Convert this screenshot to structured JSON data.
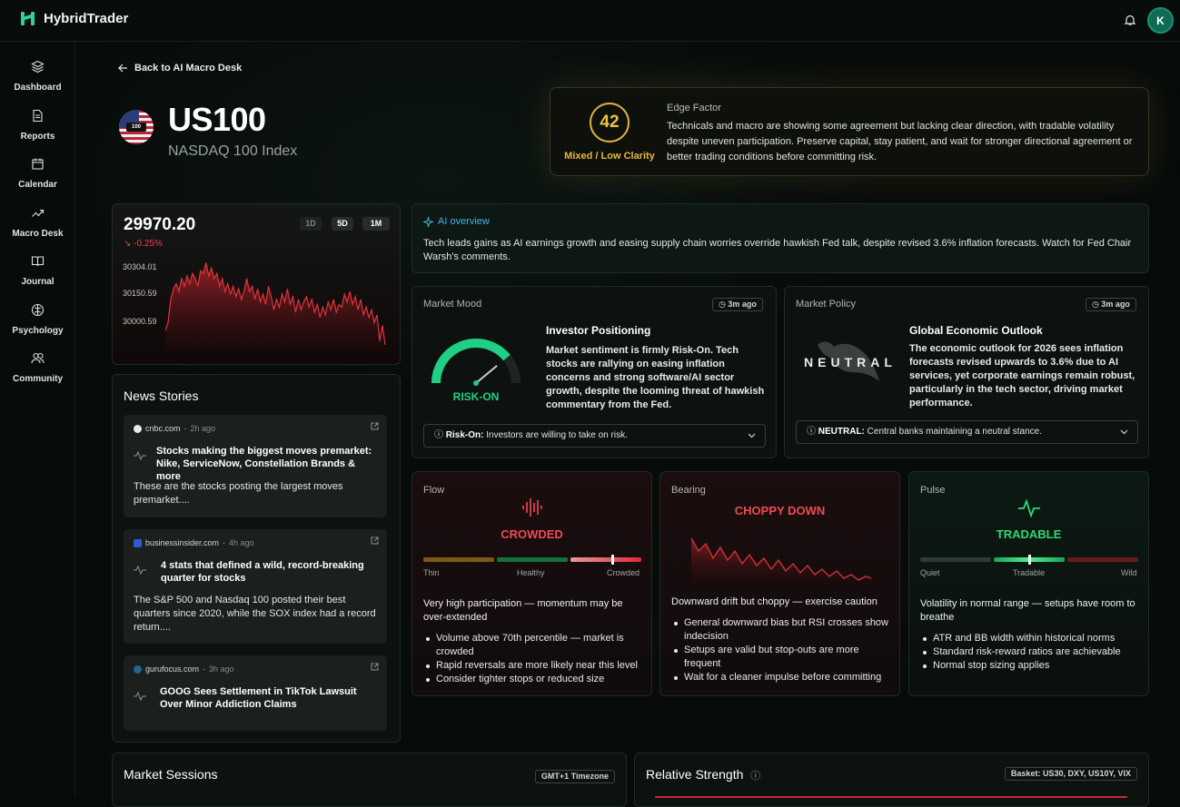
{
  "app": {
    "name": "HybridTrader",
    "user_initial": "K"
  },
  "nav": [
    {
      "label": "Dashboard",
      "icon": "layers-icon"
    },
    {
      "label": "Reports",
      "icon": "document-icon"
    },
    {
      "label": "Calendar",
      "icon": "calendar-icon"
    },
    {
      "label": "Macro Desk",
      "icon": "trend-up-icon"
    },
    {
      "label": "Journal",
      "icon": "book-icon"
    },
    {
      "label": "Psychology",
      "icon": "brain-icon"
    },
    {
      "label": "Community",
      "icon": "users-icon"
    }
  ],
  "back_link": "Back to AI Macro Desk",
  "instrument": {
    "symbol": "US100",
    "name": "NASDAQ 100 Index",
    "flag_tag": "100"
  },
  "edge": {
    "score": "42",
    "label": "Mixed / Low Clarity",
    "title": "Edge Factor",
    "text": "Technicals and macro are showing some agreement but lacking clear direction, with tradable volatility despite uneven participation. Preserve capital, stay patient, and wait for stronger directional agreement or better trading conditions before committing risk."
  },
  "price_card": {
    "price": "29970.20",
    "change": "-0.25%",
    "ranges": [
      "1D",
      "5D",
      "1M"
    ],
    "active_range": "1M",
    "y_labels": [
      "30304.01",
      "30150.59",
      "30000.59"
    ]
  },
  "chart_data": {
    "type": "area",
    "title": "",
    "color": "#e0333d",
    "ylim": [
      29950,
      30320
    ],
    "y_ticks": [
      30304.01,
      30150.59,
      30000.59
    ],
    "values": [
      30030,
      30060,
      30150,
      30190,
      30210,
      30180,
      30230,
      30200,
      30240,
      30210,
      30250,
      30230,
      30200,
      30260,
      30250,
      30290,
      30240,
      30270,
      30230,
      30250,
      30200,
      30230,
      30180,
      30210,
      30170,
      30200,
      30160,
      30190,
      30150,
      30180,
      30230,
      30180,
      30200,
      30150,
      30190,
      30140,
      30170,
      30130,
      30200,
      30160,
      30110,
      30150,
      30120,
      30170,
      30140,
      30190,
      30130,
      30160,
      30100,
      30150,
      30110,
      30140,
      30160,
      30120,
      30150,
      30100,
      30130,
      30080,
      30120,
      30090,
      30140,
      30110,
      30150,
      30100,
      30130,
      30120,
      30170,
      30140,
      30180,
      30130,
      30160,
      30110,
      30150,
      30090,
      30120,
      30080,
      30110,
      30060,
      30090,
      29990,
      30050,
      29975
    ]
  },
  "overview": {
    "title": "AI overview",
    "text": "Tech leads gains as AI earnings growth and easing supply chain worries override hawkish Fed talk, despite revised 3.6% inflation forecasts. Watch for Fed Chair Warsh's comments."
  },
  "mood": {
    "title": "Market Mood",
    "badge": "3m ago",
    "gauge_label": "RISK-ON",
    "gauge_level": 0.78,
    "heading": "Investor Positioning",
    "text": "Market sentiment is firmly Risk-On. Tech stocks are rallying on easing inflation concerns and strong software/AI sector growth, despite the looming threat of hawkish commentary from the Fed.",
    "dropdown_key": "Risk-On:",
    "dropdown_text": "Investors are willing to take on risk."
  },
  "policy": {
    "title": "Market Policy",
    "badge": "3m ago",
    "stance": "NEUTRAL",
    "heading": "Global Economic Outlook",
    "text": "The economic outlook for 2026 sees inflation forecasts revised upwards to 3.6% due to AI services, yet corporate earnings remain robust, particularly in the tech sector, driving market performance.",
    "dropdown_key": "NEUTRAL:",
    "dropdown_text": "Central banks maintaining a neutral stance."
  },
  "news": {
    "title": "News Stories",
    "items": [
      {
        "source": "cnbc.com",
        "time": "2h ago",
        "headline": "Stocks making the biggest moves premarket: Nike, ServiceNow, Constellation Brands & more",
        "desc": "These are the stocks posting the largest moves premarket...."
      },
      {
        "source": "businessinsider.com",
        "time": "4h ago",
        "headline": "4 stats that defined a wild, record-breaking quarter for stocks",
        "desc": "The S&P 500 and Nasdaq 100 posted their best quarters since 2020, while the SOX index had a record return...."
      },
      {
        "source": "gurufocus.com",
        "time": "3h ago",
        "headline": "GOOG Sees Settlement in TikTok Lawsuit Over Minor Addiction Claims",
        "desc": ""
      }
    ]
  },
  "flow": {
    "title": "Flow",
    "label": "CROWDED",
    "color": "#ef4a55",
    "level": 0.87,
    "scale": [
      "Thin",
      "Healthy",
      "Crowded"
    ],
    "summary": "Very high participation — momentum may be over-extended",
    "bullets": [
      "Volume above 70th percentile — market is crowded",
      "Rapid reversals are more likely near this level",
      "Consider tighter stops or reduced size"
    ]
  },
  "bearing": {
    "title": "Bearing",
    "label": "CHOPPY DOWN",
    "color": "#ef4a55",
    "summary": "Downward drift but choppy — exercise caution",
    "bullets": [
      "General downward bias but RSI crosses show indecision",
      "Setups are valid but stop-outs are more frequent",
      "Wait for a cleaner impulse before committing"
    ]
  },
  "pulse": {
    "title": "Pulse",
    "label": "TRADABLE",
    "color": "#2bd97a",
    "level": 0.5,
    "scale": [
      "Quiet",
      "Tradable",
      "Wild"
    ],
    "summary": "Volatility in normal range — setups have room to breathe",
    "bullets": [
      "ATR and BB width within historical norms",
      "Standard risk-reward ratios are achievable",
      "Normal stop sizing applies"
    ]
  },
  "sessions": {
    "title": "Market Sessions",
    "badge": "GMT+1 Timezone"
  },
  "relative": {
    "title": "Relative Strength",
    "badge": "Basket: US30, DXY, US10Y, VIX"
  }
}
